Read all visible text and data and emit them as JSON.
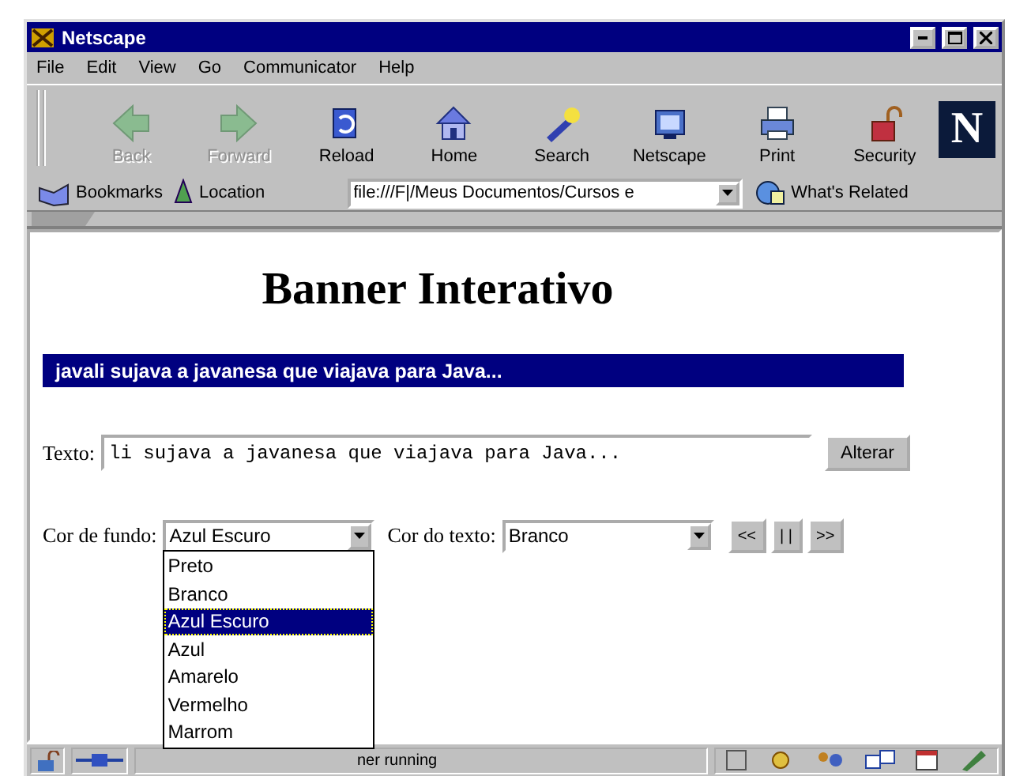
{
  "window": {
    "title": "Netscape"
  },
  "menu": [
    "File",
    "Edit",
    "View",
    "Go",
    "Communicator",
    "Help"
  ],
  "toolbar": [
    {
      "label": "Back",
      "disabled": true
    },
    {
      "label": "Forward",
      "disabled": true
    },
    {
      "label": "Reload",
      "disabled": false
    },
    {
      "label": "Home",
      "disabled": false
    },
    {
      "label": "Search",
      "disabled": false
    },
    {
      "label": "Netscape",
      "disabled": false
    },
    {
      "label": "Print",
      "disabled": false
    },
    {
      "label": "Security",
      "disabled": false
    }
  ],
  "logo": "N",
  "location_bar": {
    "bookmarks": "Bookmarks",
    "label": "Location",
    "value": "file:///F|/Meus Documentos/Cursos e",
    "related": "What's Related"
  },
  "page": {
    "heading": "Banner Interativo",
    "banner": "javali sujava a javanesa que viajava para Java...",
    "text_label": "Texto:",
    "text_value": "li sujava a javanesa que viajava para Java...",
    "apply_button": "Alterar",
    "selects": [
      {
        "label": "Cor de fundo:",
        "value": "Azul Escuro",
        "expanded": true
      },
      {
        "label": "Cor do texto:",
        "value": "Branco",
        "expanded": false
      }
    ],
    "nav_buttons": [
      "<<",
      "| |",
      ">>"
    ],
    "options": [
      {
        "label": "Preto",
        "selected": false
      },
      {
        "label": "Branco",
        "selected": false
      },
      {
        "label": "Azul Escuro",
        "selected": true
      },
      {
        "label": "Azul",
        "selected": false
      },
      {
        "label": "Amarelo",
        "selected": false
      },
      {
        "label": "Vermelho",
        "selected": false
      },
      {
        "label": "Marrom",
        "selected": false
      }
    ]
  },
  "status_bar": {
    "text": "ner running"
  }
}
